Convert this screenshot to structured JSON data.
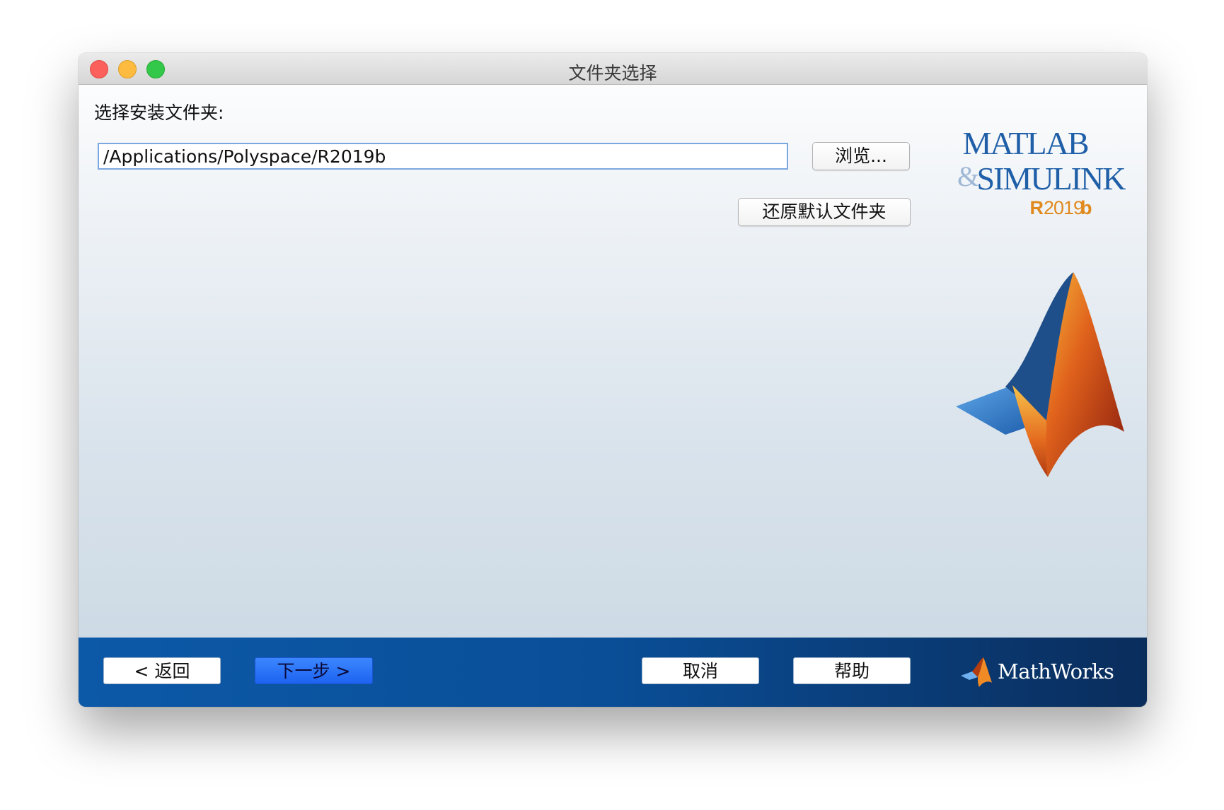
{
  "window": {
    "title": "文件夹选择"
  },
  "main": {
    "prompt_label": "选择安装文件夹:",
    "path_value": "/Applications/Polyspace/R2019b",
    "browse_label": "浏览...",
    "restore_label": "还原默认文件夹"
  },
  "logo": {
    "matlab_word": "MATLAB",
    "ampersand": "&",
    "simulink_word": "SIMULINK",
    "release_r": "R",
    "release_year": "2019",
    "release_b": "b"
  },
  "footer": {
    "back_label": "< 返回",
    "next_label": "下一步 >",
    "cancel_label": "取消",
    "help_label": "帮助",
    "brand": "MathWorks"
  },
  "colors": {
    "accent_blue": "#1d63f0",
    "footer_blue": "#0a4e97",
    "release_orange": "#e08a1e",
    "logo_blue": "#1f5fa8"
  },
  "icons": {
    "close": "close-traffic-light",
    "minimize": "minimize-traffic-light",
    "zoom": "zoom-traffic-light",
    "membrane": "matlab-membrane-icon",
    "mathworks": "mathworks-logo-icon"
  }
}
